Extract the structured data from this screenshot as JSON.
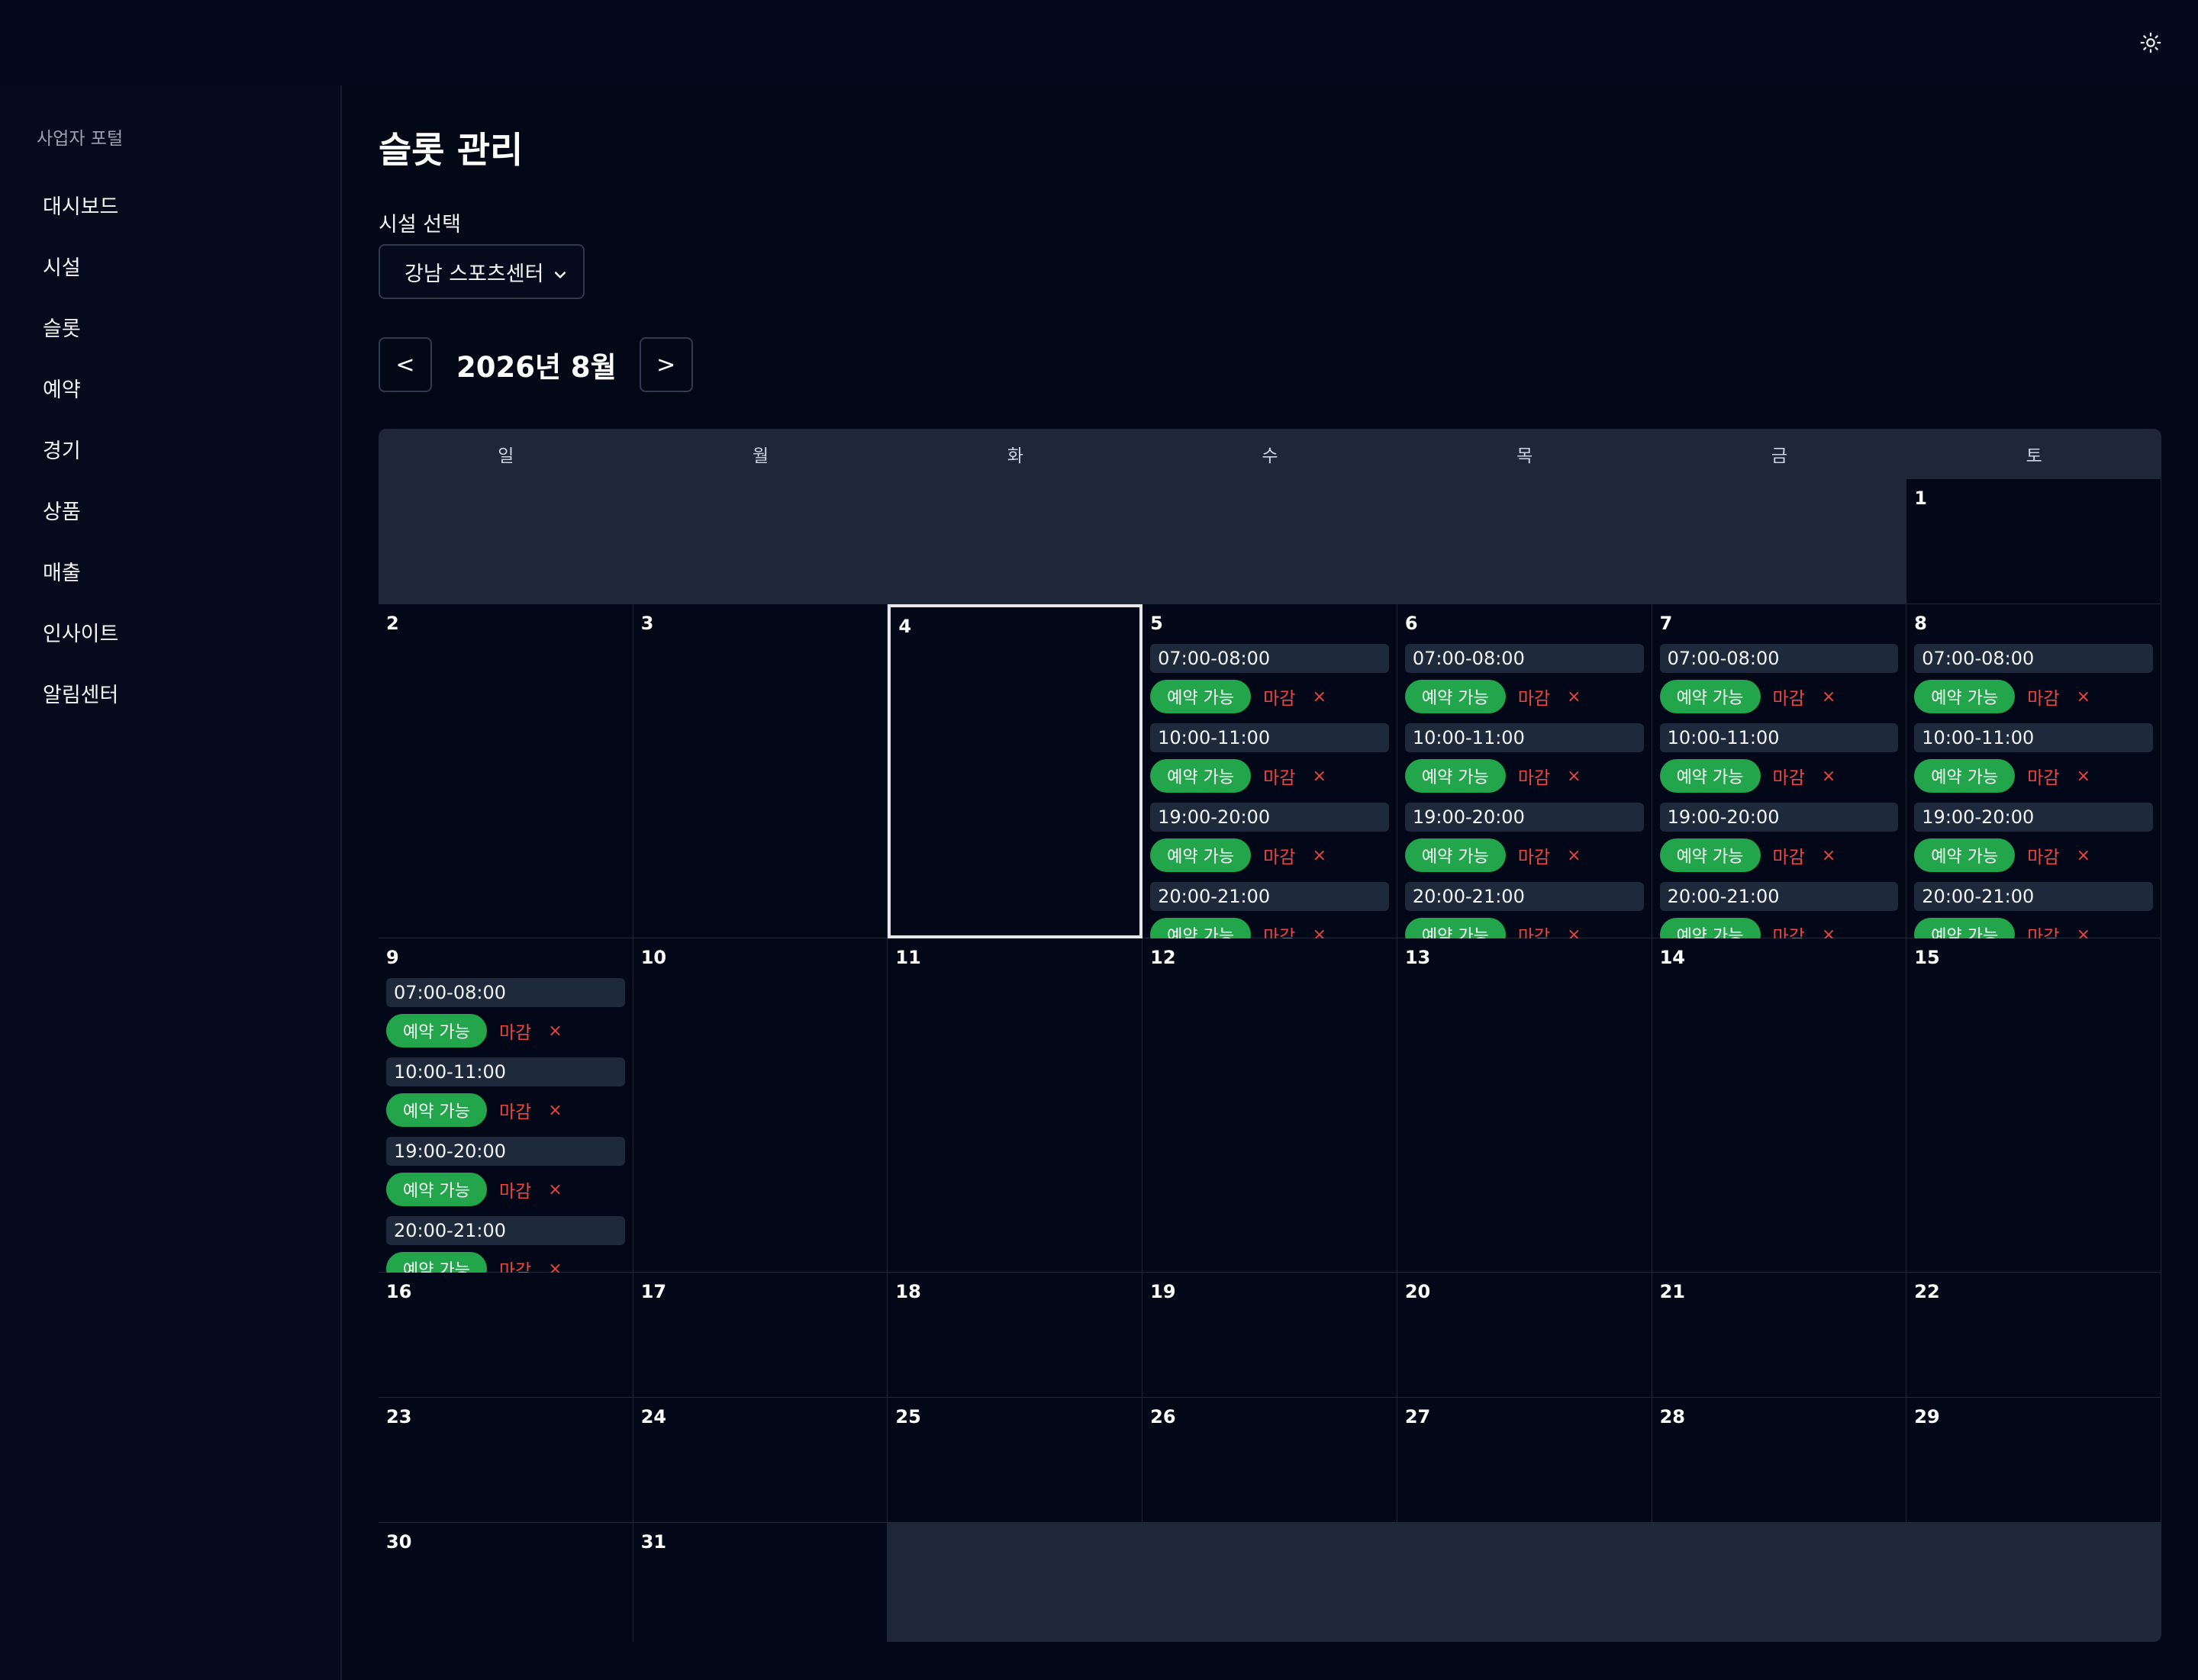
{
  "sidebar": {
    "title": "사업자 포털",
    "items": [
      {
        "label": "대시보드",
        "name": "sidebar-item-dashboard"
      },
      {
        "label": "시설",
        "name": "sidebar-item-facilities"
      },
      {
        "label": "슬롯",
        "name": "sidebar-item-slots"
      },
      {
        "label": "예약",
        "name": "sidebar-item-reservations"
      },
      {
        "label": "경기",
        "name": "sidebar-item-matches"
      },
      {
        "label": "상품",
        "name": "sidebar-item-products"
      },
      {
        "label": "매출",
        "name": "sidebar-item-sales"
      },
      {
        "label": "인사이트",
        "name": "sidebar-item-insights"
      },
      {
        "label": "알림센터",
        "name": "sidebar-item-notifications"
      }
    ]
  },
  "header": {
    "theme_icon": "sun-icon"
  },
  "main": {
    "title": "슬롯 관리",
    "facility_label": "시설 선택",
    "facility_selected": "강남 스포츠센터",
    "month_label": "2026년 8월",
    "prev_label": "<",
    "next_label": ">"
  },
  "calendar": {
    "weekdays": [
      "일",
      "월",
      "화",
      "수",
      "목",
      "금",
      "토"
    ],
    "first_weekday_index": 6,
    "today": 4,
    "status_label": "예약 가능",
    "close_label": "마감",
    "delete_label": "×",
    "days": [
      {
        "day": "1",
        "slots": []
      },
      {
        "day": "2",
        "slots": []
      },
      {
        "day": "3",
        "slots": []
      },
      {
        "day": "4",
        "slots": []
      },
      {
        "day": "5",
        "slots": [
          "07:00-08:00",
          "10:00-11:00",
          "19:00-20:00",
          "20:00-21:00"
        ]
      },
      {
        "day": "6",
        "slots": [
          "07:00-08:00",
          "10:00-11:00",
          "19:00-20:00",
          "20:00-21:00"
        ]
      },
      {
        "day": "7",
        "slots": [
          "07:00-08:00",
          "10:00-11:00",
          "19:00-20:00",
          "20:00-21:00"
        ]
      },
      {
        "day": "8",
        "slots": [
          "07:00-08:00",
          "10:00-11:00",
          "19:00-20:00",
          "20:00-21:00"
        ]
      },
      {
        "day": "9",
        "slots": [
          "07:00-08:00",
          "10:00-11:00",
          "19:00-20:00",
          "20:00-21:00"
        ]
      },
      {
        "day": "10",
        "slots": []
      },
      {
        "day": "11",
        "slots": []
      },
      {
        "day": "12",
        "slots": []
      },
      {
        "day": "13",
        "slots": []
      },
      {
        "day": "14",
        "slots": []
      },
      {
        "day": "15",
        "slots": []
      },
      {
        "day": "16",
        "slots": []
      },
      {
        "day": "17",
        "slots": []
      },
      {
        "day": "18",
        "slots": []
      },
      {
        "day": "19",
        "slots": []
      },
      {
        "day": "20",
        "slots": []
      },
      {
        "day": "21",
        "slots": []
      },
      {
        "day": "22",
        "slots": []
      },
      {
        "day": "23",
        "slots": []
      },
      {
        "day": "24",
        "slots": []
      },
      {
        "day": "25",
        "slots": []
      },
      {
        "day": "26",
        "slots": []
      },
      {
        "day": "27",
        "slots": []
      },
      {
        "day": "28",
        "slots": []
      },
      {
        "day": "29",
        "slots": []
      },
      {
        "day": "30",
        "slots": []
      },
      {
        "day": "31",
        "slots": []
      }
    ]
  },
  "colors": {
    "background": "#030816",
    "sidebar": "#050b1d",
    "slot_time_bg": "#1e293b",
    "badge_available": "#22a54b",
    "close_red": "#ef4444",
    "calendar_empty": "#1e2738"
  }
}
